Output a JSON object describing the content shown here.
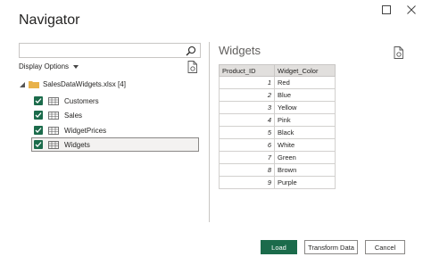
{
  "dialog": {
    "title": "Navigator"
  },
  "window_controls": {
    "maximize_icon": "maximize-icon",
    "close_icon": "close-icon"
  },
  "left_pane": {
    "search_placeholder": "",
    "display_options_label": "Display Options",
    "file_name": "SalesDataWidgets.xlsx [4]",
    "items": [
      {
        "label": "Customers",
        "checked": true,
        "selected": false
      },
      {
        "label": "Sales",
        "checked": true,
        "selected": false
      },
      {
        "label": "WidgetPrices",
        "checked": true,
        "selected": false
      },
      {
        "label": "Widgets",
        "checked": true,
        "selected": true
      }
    ]
  },
  "preview": {
    "title": "Widgets",
    "columns": [
      "Product_ID",
      "Widget_Color"
    ],
    "rows": [
      [
        "1",
        "Red"
      ],
      [
        "2",
        "Blue"
      ],
      [
        "3",
        "Yellow"
      ],
      [
        "4",
        "Pink"
      ],
      [
        "5",
        "Black"
      ],
      [
        "6",
        "White"
      ],
      [
        "7",
        "Green"
      ],
      [
        "8",
        "Brown"
      ],
      [
        "9",
        "Purple"
      ]
    ]
  },
  "footer": {
    "load_label": "Load",
    "transform_label": "Transform Data",
    "cancel_label": "Cancel"
  },
  "colors": {
    "accent": "#1b6b4b"
  }
}
